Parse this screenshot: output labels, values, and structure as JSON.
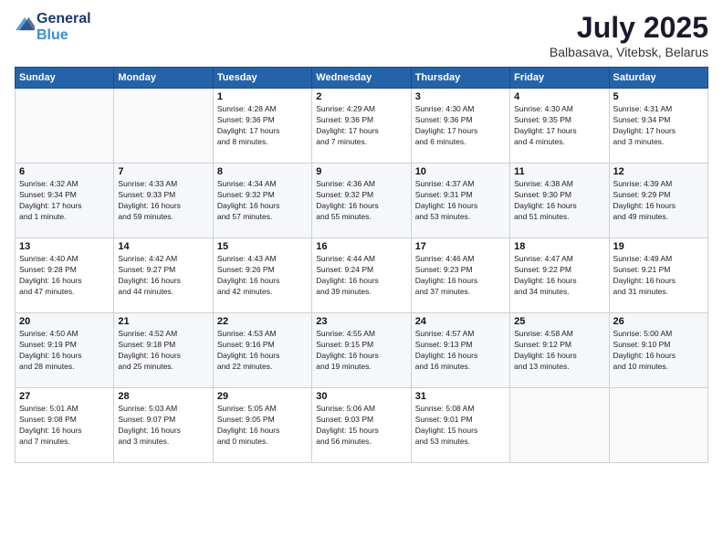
{
  "header": {
    "logo_line1": "General",
    "logo_line2": "Blue",
    "month_year": "July 2025",
    "location": "Balbasava, Vitebsk, Belarus"
  },
  "weekdays": [
    "Sunday",
    "Monday",
    "Tuesday",
    "Wednesday",
    "Thursday",
    "Friday",
    "Saturday"
  ],
  "weeks": [
    [
      {
        "day": "",
        "detail": ""
      },
      {
        "day": "",
        "detail": ""
      },
      {
        "day": "1",
        "detail": "Sunrise: 4:28 AM\nSunset: 9:36 PM\nDaylight: 17 hours\nand 8 minutes."
      },
      {
        "day": "2",
        "detail": "Sunrise: 4:29 AM\nSunset: 9:36 PM\nDaylight: 17 hours\nand 7 minutes."
      },
      {
        "day": "3",
        "detail": "Sunrise: 4:30 AM\nSunset: 9:36 PM\nDaylight: 17 hours\nand 6 minutes."
      },
      {
        "day": "4",
        "detail": "Sunrise: 4:30 AM\nSunset: 9:35 PM\nDaylight: 17 hours\nand 4 minutes."
      },
      {
        "day": "5",
        "detail": "Sunrise: 4:31 AM\nSunset: 9:34 PM\nDaylight: 17 hours\nand 3 minutes."
      }
    ],
    [
      {
        "day": "6",
        "detail": "Sunrise: 4:32 AM\nSunset: 9:34 PM\nDaylight: 17 hours\nand 1 minute."
      },
      {
        "day": "7",
        "detail": "Sunrise: 4:33 AM\nSunset: 9:33 PM\nDaylight: 16 hours\nand 59 minutes."
      },
      {
        "day": "8",
        "detail": "Sunrise: 4:34 AM\nSunset: 9:32 PM\nDaylight: 16 hours\nand 57 minutes."
      },
      {
        "day": "9",
        "detail": "Sunrise: 4:36 AM\nSunset: 9:32 PM\nDaylight: 16 hours\nand 55 minutes."
      },
      {
        "day": "10",
        "detail": "Sunrise: 4:37 AM\nSunset: 9:31 PM\nDaylight: 16 hours\nand 53 minutes."
      },
      {
        "day": "11",
        "detail": "Sunrise: 4:38 AM\nSunset: 9:30 PM\nDaylight: 16 hours\nand 51 minutes."
      },
      {
        "day": "12",
        "detail": "Sunrise: 4:39 AM\nSunset: 9:29 PM\nDaylight: 16 hours\nand 49 minutes."
      }
    ],
    [
      {
        "day": "13",
        "detail": "Sunrise: 4:40 AM\nSunset: 9:28 PM\nDaylight: 16 hours\nand 47 minutes."
      },
      {
        "day": "14",
        "detail": "Sunrise: 4:42 AM\nSunset: 9:27 PM\nDaylight: 16 hours\nand 44 minutes."
      },
      {
        "day": "15",
        "detail": "Sunrise: 4:43 AM\nSunset: 9:26 PM\nDaylight: 16 hours\nand 42 minutes."
      },
      {
        "day": "16",
        "detail": "Sunrise: 4:44 AM\nSunset: 9:24 PM\nDaylight: 16 hours\nand 39 minutes."
      },
      {
        "day": "17",
        "detail": "Sunrise: 4:46 AM\nSunset: 9:23 PM\nDaylight: 16 hours\nand 37 minutes."
      },
      {
        "day": "18",
        "detail": "Sunrise: 4:47 AM\nSunset: 9:22 PM\nDaylight: 16 hours\nand 34 minutes."
      },
      {
        "day": "19",
        "detail": "Sunrise: 4:49 AM\nSunset: 9:21 PM\nDaylight: 16 hours\nand 31 minutes."
      }
    ],
    [
      {
        "day": "20",
        "detail": "Sunrise: 4:50 AM\nSunset: 9:19 PM\nDaylight: 16 hours\nand 28 minutes."
      },
      {
        "day": "21",
        "detail": "Sunrise: 4:52 AM\nSunset: 9:18 PM\nDaylight: 16 hours\nand 25 minutes."
      },
      {
        "day": "22",
        "detail": "Sunrise: 4:53 AM\nSunset: 9:16 PM\nDaylight: 16 hours\nand 22 minutes."
      },
      {
        "day": "23",
        "detail": "Sunrise: 4:55 AM\nSunset: 9:15 PM\nDaylight: 16 hours\nand 19 minutes."
      },
      {
        "day": "24",
        "detail": "Sunrise: 4:57 AM\nSunset: 9:13 PM\nDaylight: 16 hours\nand 16 minutes."
      },
      {
        "day": "25",
        "detail": "Sunrise: 4:58 AM\nSunset: 9:12 PM\nDaylight: 16 hours\nand 13 minutes."
      },
      {
        "day": "26",
        "detail": "Sunrise: 5:00 AM\nSunset: 9:10 PM\nDaylight: 16 hours\nand 10 minutes."
      }
    ],
    [
      {
        "day": "27",
        "detail": "Sunrise: 5:01 AM\nSunset: 9:08 PM\nDaylight: 16 hours\nand 7 minutes."
      },
      {
        "day": "28",
        "detail": "Sunrise: 5:03 AM\nSunset: 9:07 PM\nDaylight: 16 hours\nand 3 minutes."
      },
      {
        "day": "29",
        "detail": "Sunrise: 5:05 AM\nSunset: 9:05 PM\nDaylight: 16 hours\nand 0 minutes."
      },
      {
        "day": "30",
        "detail": "Sunrise: 5:06 AM\nSunset: 9:03 PM\nDaylight: 15 hours\nand 56 minutes."
      },
      {
        "day": "31",
        "detail": "Sunrise: 5:08 AM\nSunset: 9:01 PM\nDaylight: 15 hours\nand 53 minutes."
      },
      {
        "day": "",
        "detail": ""
      },
      {
        "day": "",
        "detail": ""
      }
    ]
  ]
}
